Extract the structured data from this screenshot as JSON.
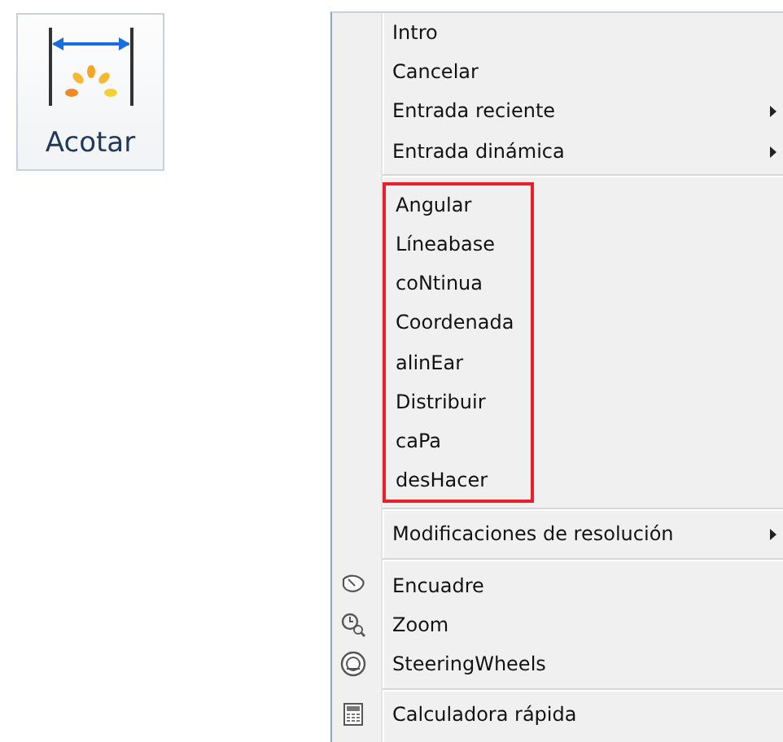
{
  "ribbon_button": {
    "label": "Acotar"
  },
  "menu": {
    "sections": [
      {
        "highlighted": false,
        "items": [
          {
            "label": "Intro",
            "submenu": false
          },
          {
            "label": "Cancelar",
            "submenu": false
          },
          {
            "label": "Entrada reciente",
            "submenu": true
          },
          {
            "label": "Entrada dinámica",
            "submenu": true
          }
        ]
      },
      {
        "highlighted": true,
        "items": [
          {
            "label": "Angular",
            "submenu": false
          },
          {
            "label": "Líneabase",
            "submenu": false
          },
          {
            "label": "coNtinua",
            "submenu": false
          },
          {
            "label": "Coordenada",
            "submenu": false
          },
          {
            "label": "alinEar",
            "submenu": false
          },
          {
            "label": "Distribuir",
            "submenu": false
          },
          {
            "label": "caPa",
            "submenu": false
          },
          {
            "label": "desHacer",
            "submenu": false
          }
        ]
      },
      {
        "highlighted": false,
        "items": [
          {
            "label": "Modificaciones de resolución",
            "submenu": true
          }
        ]
      },
      {
        "highlighted": false,
        "items": [
          {
            "label": "Encuadre",
            "submenu": false,
            "kind": "pan"
          },
          {
            "label": "Zoom",
            "submenu": false,
            "kind": "zoom"
          },
          {
            "label": "SteeringWheels",
            "submenu": false,
            "kind": "wheel"
          }
        ]
      },
      {
        "highlighted": false,
        "items": [
          {
            "label": "Calculadora rápida",
            "submenu": false,
            "kind": "calculator"
          }
        ]
      }
    ]
  }
}
